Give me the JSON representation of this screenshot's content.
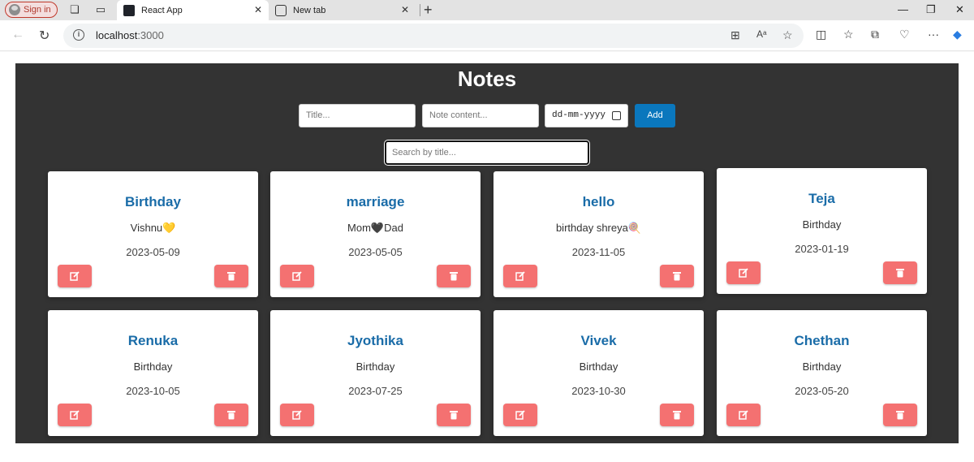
{
  "browser": {
    "sign_in": "Sign in",
    "tabs": [
      {
        "label": "React App",
        "active": true
      },
      {
        "label": "New tab",
        "active": false
      }
    ],
    "url_host": "localhost",
    "url_port": ":3000"
  },
  "app": {
    "heading": "Notes",
    "form": {
      "title_placeholder": "Title...",
      "content_placeholder": "Note content...",
      "date_placeholder": "dd-mm-yyyy",
      "add_label": "Add"
    },
    "search_placeholder": "Search by title...",
    "notes": [
      {
        "title": "Birthday",
        "content": "Vishnu💛",
        "date": "2023-05-09"
      },
      {
        "title": "marriage",
        "content": "Mom🖤Dad",
        "date": "2023-05-05"
      },
      {
        "title": "hello",
        "content": "birthday shreya🍭",
        "date": "2023-11-05"
      },
      {
        "title": "Teja",
        "content": "Birthday",
        "date": "2023-01-19"
      },
      {
        "title": "Renuka",
        "content": "Birthday",
        "date": "2023-10-05"
      },
      {
        "title": "Jyothika",
        "content": "Birthday",
        "date": "2023-07-25"
      },
      {
        "title": "Vivek",
        "content": "Birthday",
        "date": "2023-10-30"
      },
      {
        "title": "Chethan",
        "content": "Birthday",
        "date": "2023-05-20"
      }
    ]
  },
  "colors": {
    "app_bg": "#333333",
    "accent_blue": "#0a77bd",
    "note_title": "#1a6ca8",
    "button_red": "#f47171"
  }
}
